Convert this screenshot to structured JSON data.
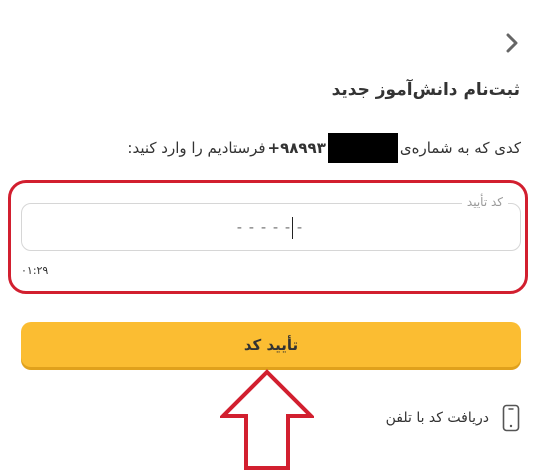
{
  "header": {
    "back_icon": "chevron-right-icon",
    "title": "ثبت‌نام دانش‌آموز جدید"
  },
  "instruction": {
    "before": "کدی که به شماره‌ی",
    "phone_prefix": "+۹۸۹۹۳",
    "after": "فرستادیم را وارد کنید:"
  },
  "code_field": {
    "label": "کد تأیید",
    "placeholder": "------"
  },
  "timer": "۰۱:۲۹",
  "confirm_button": {
    "label": "تأیید کد",
    "color": "#fbbd32"
  },
  "phone_call": {
    "icon": "phone-icon",
    "label": "دریافت کد با تلفن"
  },
  "annotation": {
    "color": "#d21f2f"
  }
}
